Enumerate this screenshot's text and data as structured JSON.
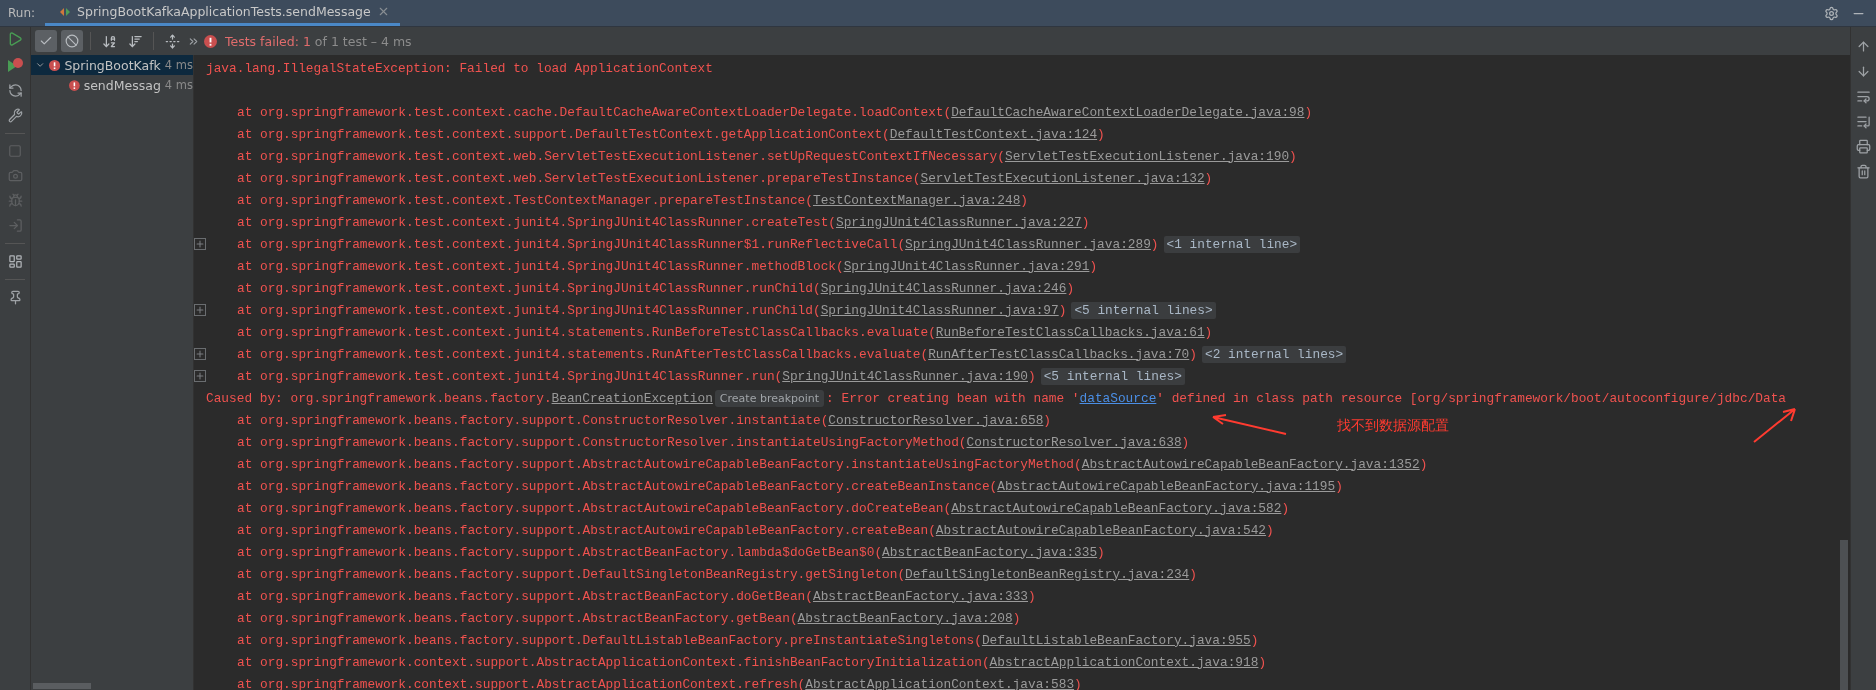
{
  "header": {
    "label": "Run:",
    "tab": {
      "title": "SpringBootKafkaApplicationTests.sendMessage",
      "selected": true
    }
  },
  "toolbar": {
    "filters": [
      {
        "kind": "passed",
        "selected": true
      },
      {
        "kind": "ignored",
        "selected": true
      }
    ],
    "status": {
      "failed": "Tests failed: 1",
      "detail": "of 1 test – 4 ms"
    }
  },
  "tree": [
    {
      "name": "SpringBootKafk",
      "duration": "4 ms",
      "selected": true,
      "expanded": true,
      "children": [
        {
          "name": "sendMessag",
          "duration": "4 ms",
          "selected": false,
          "expanded": false
        }
      ]
    }
  ],
  "console": {
    "rows": [
      {
        "kind": "header",
        "segments": [
          {
            "kind": "text",
            "text": "java.lang.IllegalStateException: Failed to load ApplicationContext"
          }
        ]
      },
      {
        "kind": "frame",
        "expandable": false,
        "segments": [
          {
            "kind": "text",
            "text": "at org.springframework.test.context.cache.DefaultCacheAwareContextLoaderDelegate.loadContext("
          },
          {
            "kind": "link",
            "text": "DefaultCacheAwareContextLoaderDelegate.java:98"
          },
          {
            "kind": "text",
            "text": ")"
          }
        ]
      },
      {
        "kind": "frame",
        "expandable": false,
        "segments": [
          {
            "kind": "text",
            "text": "at org.springframework.test.context.support.DefaultTestContext.getApplicationContext("
          },
          {
            "kind": "link",
            "text": "DefaultTestContext.java:124"
          },
          {
            "kind": "text",
            "text": ")"
          }
        ]
      },
      {
        "kind": "frame",
        "expandable": false,
        "segments": [
          {
            "kind": "text",
            "text": "at org.springframework.test.context.web.ServletTestExecutionListener.setUpRequestContextIfNecessary("
          },
          {
            "kind": "link",
            "text": "ServletTestExecutionListener.java:190"
          },
          {
            "kind": "text",
            "text": ")"
          }
        ]
      },
      {
        "kind": "frame",
        "expandable": false,
        "segments": [
          {
            "kind": "text",
            "text": "at org.springframework.test.context.web.ServletTestExecutionListener.prepareTestInstance("
          },
          {
            "kind": "link",
            "text": "ServletTestExecutionListener.java:132"
          },
          {
            "kind": "text",
            "text": ")"
          }
        ]
      },
      {
        "kind": "frame",
        "expandable": false,
        "segments": [
          {
            "kind": "text",
            "text": "at org.springframework.test.context.TestContextManager.prepareTestInstance("
          },
          {
            "kind": "link",
            "text": "TestContextManager.java:248"
          },
          {
            "kind": "text",
            "text": ")"
          }
        ]
      },
      {
        "kind": "frame",
        "expandable": false,
        "segments": [
          {
            "kind": "text",
            "text": "at org.springframework.test.context.junit4.SpringJUnit4ClassRunner.createTest("
          },
          {
            "kind": "link",
            "text": "SpringJUnit4ClassRunner.java:227"
          },
          {
            "kind": "text",
            "text": ")"
          }
        ]
      },
      {
        "kind": "frame",
        "expandable": true,
        "segments": [
          {
            "kind": "text",
            "text": "at org.springframework.test.context.junit4.SpringJUnit4ClassRunner$1.runReflectiveCall("
          },
          {
            "kind": "link",
            "text": "SpringJUnit4ClassRunner.java:289"
          },
          {
            "kind": "text",
            "text": ")"
          },
          {
            "kind": "fold",
            "text": "<1 internal line>"
          }
        ]
      },
      {
        "kind": "frame",
        "expandable": false,
        "segments": [
          {
            "kind": "text",
            "text": "at org.springframework.test.context.junit4.SpringJUnit4ClassRunner.methodBlock("
          },
          {
            "kind": "link",
            "text": "SpringJUnit4ClassRunner.java:291"
          },
          {
            "kind": "text",
            "text": ")"
          }
        ]
      },
      {
        "kind": "frame",
        "expandable": false,
        "segments": [
          {
            "kind": "text",
            "text": "at org.springframework.test.context.junit4.SpringJUnit4ClassRunner.runChild("
          },
          {
            "kind": "link",
            "text": "SpringJUnit4ClassRunner.java:246"
          },
          {
            "kind": "text",
            "text": ")"
          }
        ]
      },
      {
        "kind": "frame",
        "expandable": true,
        "segments": [
          {
            "kind": "text",
            "text": "at org.springframework.test.context.junit4.SpringJUnit4ClassRunner.runChild("
          },
          {
            "kind": "link",
            "text": "SpringJUnit4ClassRunner.java:97"
          },
          {
            "kind": "text",
            "text": ")"
          },
          {
            "kind": "fold",
            "text": "<5 internal lines>"
          }
        ]
      },
      {
        "kind": "frame",
        "expandable": false,
        "segments": [
          {
            "kind": "text",
            "text": "at org.springframework.test.context.junit4.statements.RunBeforeTestClassCallbacks.evaluate("
          },
          {
            "kind": "link",
            "text": "RunBeforeTestClassCallbacks.java:61"
          },
          {
            "kind": "text",
            "text": ")"
          }
        ]
      },
      {
        "kind": "frame",
        "expandable": true,
        "segments": [
          {
            "kind": "text",
            "text": "at org.springframework.test.context.junit4.statements.RunAfterTestClassCallbacks.evaluate("
          },
          {
            "kind": "link",
            "text": "RunAfterTestClassCallbacks.java:70"
          },
          {
            "kind": "text",
            "text": ")"
          },
          {
            "kind": "fold",
            "text": "<2 internal lines>"
          }
        ]
      },
      {
        "kind": "frame",
        "expandable": true,
        "segments": [
          {
            "kind": "text",
            "text": "at org.springframework.test.context.junit4.SpringJUnit4ClassRunner.run("
          },
          {
            "kind": "link",
            "text": "SpringJUnit4ClassRunner.java:190"
          },
          {
            "kind": "text",
            "text": ")"
          },
          {
            "kind": "fold",
            "text": "<5 internal lines>"
          }
        ]
      },
      {
        "kind": "cause",
        "segments": [
          {
            "kind": "text",
            "text": "Caused by: org.springframework.beans.factory."
          },
          {
            "kind": "link",
            "text": "BeanCreationException"
          },
          {
            "kind": "tooltip",
            "text": "Create breakpoint"
          },
          {
            "kind": "text",
            "text": ": Error creating bean with name '"
          },
          {
            "kind": "hyperlink",
            "text": "dataSource"
          },
          {
            "kind": "text",
            "text": "' defined in class path resource [org/springframework/boot/autoconfigure/jdbc/Data"
          }
        ]
      },
      {
        "kind": "frame",
        "expandable": false,
        "segments": [
          {
            "kind": "text",
            "text": "at org.springframework.beans.factory.support.ConstructorResolver.instantiate("
          },
          {
            "kind": "link",
            "text": "ConstructorResolver.java:658"
          },
          {
            "kind": "text",
            "text": ")"
          }
        ]
      },
      {
        "kind": "frame",
        "expandable": false,
        "segments": [
          {
            "kind": "text",
            "text": "at org.springframework.beans.factory.support.ConstructorResolver.instantiateUsingFactoryMethod("
          },
          {
            "kind": "link",
            "text": "ConstructorResolver.java:638"
          },
          {
            "kind": "text",
            "text": ")"
          }
        ]
      },
      {
        "kind": "frame",
        "expandable": false,
        "segments": [
          {
            "kind": "text",
            "text": "at org.springframework.beans.factory.support.AbstractAutowireCapableBeanFactory.instantiateUsingFactoryMethod("
          },
          {
            "kind": "link",
            "text": "AbstractAutowireCapableBeanFactory.java:1352"
          },
          {
            "kind": "text",
            "text": ")"
          }
        ]
      },
      {
        "kind": "frame",
        "expandable": false,
        "segments": [
          {
            "kind": "text",
            "text": "at org.springframework.beans.factory.support.AbstractAutowireCapableBeanFactory.createBeanInstance("
          },
          {
            "kind": "link",
            "text": "AbstractAutowireCapableBeanFactory.java:1195"
          },
          {
            "kind": "text",
            "text": ")"
          }
        ]
      },
      {
        "kind": "frame",
        "expandable": false,
        "segments": [
          {
            "kind": "text",
            "text": "at org.springframework.beans.factory.support.AbstractAutowireCapableBeanFactory.doCreateBean("
          },
          {
            "kind": "link",
            "text": "AbstractAutowireCapableBeanFactory.java:582"
          },
          {
            "kind": "text",
            "text": ")"
          }
        ]
      },
      {
        "kind": "frame",
        "expandable": false,
        "segments": [
          {
            "kind": "text",
            "text": "at org.springframework.beans.factory.support.AbstractAutowireCapableBeanFactory.createBean("
          },
          {
            "kind": "link",
            "text": "AbstractAutowireCapableBeanFactory.java:542"
          },
          {
            "kind": "text",
            "text": ")"
          }
        ]
      },
      {
        "kind": "frame",
        "expandable": false,
        "segments": [
          {
            "kind": "text",
            "text": "at org.springframework.beans.factory.support.AbstractBeanFactory.lambda$doGetBean$0("
          },
          {
            "kind": "link",
            "text": "AbstractBeanFactory.java:335"
          },
          {
            "kind": "text",
            "text": ")"
          }
        ]
      },
      {
        "kind": "frame",
        "expandable": false,
        "segments": [
          {
            "kind": "text",
            "text": "at org.springframework.beans.factory.support.DefaultSingletonBeanRegistry.getSingleton("
          },
          {
            "kind": "link",
            "text": "DefaultSingletonBeanRegistry.java:234"
          },
          {
            "kind": "text",
            "text": ")"
          }
        ]
      },
      {
        "kind": "frame",
        "expandable": false,
        "segments": [
          {
            "kind": "text",
            "text": "at org.springframework.beans.factory.support.AbstractBeanFactory.doGetBean("
          },
          {
            "kind": "link",
            "text": "AbstractBeanFactory.java:333"
          },
          {
            "kind": "text",
            "text": ")"
          }
        ]
      },
      {
        "kind": "frame",
        "expandable": false,
        "segments": [
          {
            "kind": "text",
            "text": "at org.springframework.beans.factory.support.AbstractBeanFactory.getBean("
          },
          {
            "kind": "link",
            "text": "AbstractBeanFactory.java:208"
          },
          {
            "kind": "text",
            "text": ")"
          }
        ]
      },
      {
        "kind": "frame",
        "expandable": false,
        "segments": [
          {
            "kind": "text",
            "text": "at org.springframework.beans.factory.support.DefaultListableBeanFactory.preInstantiateSingletons("
          },
          {
            "kind": "link",
            "text": "DefaultListableBeanFactory.java:955"
          },
          {
            "kind": "text",
            "text": ")"
          }
        ]
      },
      {
        "kind": "frame",
        "expandable": false,
        "segments": [
          {
            "kind": "text",
            "text": "at org.springframework.context.support.AbstractApplicationContext.finishBeanFactoryInitialization("
          },
          {
            "kind": "link",
            "text": "AbstractApplicationContext.java:918"
          },
          {
            "kind": "text",
            "text": ")"
          }
        ]
      },
      {
        "kind": "frame",
        "expandable": false,
        "segments": [
          {
            "kind": "text",
            "text": "at org.springframework.context.support.AbstractApplicationContext.refresh("
          },
          {
            "kind": "link",
            "text": "AbstractApplicationContext.java:583"
          },
          {
            "kind": "text",
            "text": ")"
          }
        ]
      }
    ],
    "annotation": {
      "text": "找不到数据源配置"
    }
  }
}
